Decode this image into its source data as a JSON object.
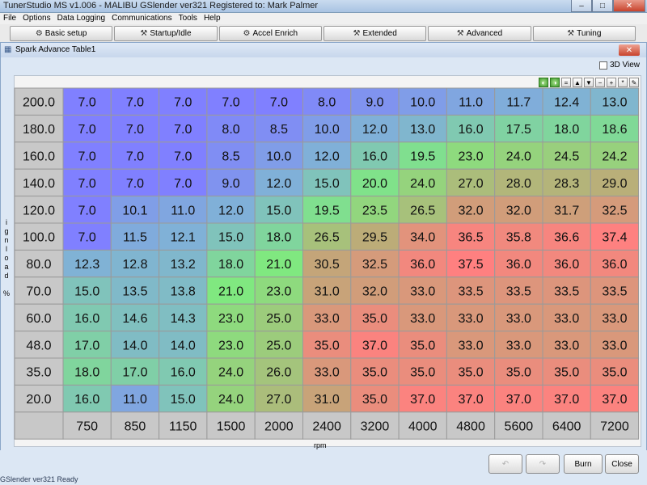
{
  "app": {
    "title": "TunerStudio MS v1.006 - MALIBU GSlender ver321 Registered to: Mark Palmer"
  },
  "window_controls": {
    "minimize": "–",
    "maximize": "□",
    "close": "✕"
  },
  "menu": [
    "File",
    "Options",
    "Data Logging",
    "Communications",
    "Tools",
    "Help"
  ],
  "toolbar": [
    {
      "label": "Basic setup",
      "icon": "engine-icon",
      "glyph": "⚙"
    },
    {
      "label": "Startup/Idle",
      "icon": "wrench-icon",
      "glyph": "⚒"
    },
    {
      "label": "Accel Enrich",
      "icon": "engine-icon",
      "glyph": "⚙"
    },
    {
      "label": "Extended",
      "icon": "hammer-icon",
      "glyph": "⚒"
    },
    {
      "label": "Advanced",
      "icon": "wrench-icon",
      "glyph": "⚒"
    },
    {
      "label": "Tuning",
      "icon": "tools-icon",
      "glyph": "⚒"
    }
  ],
  "dialog": {
    "title": "Spark Advance Table1",
    "close": "✕",
    "view3d_label": "3D View",
    "mini_toolbar": [
      "◐",
      "◑",
      "=",
      "▲",
      "▼",
      "−",
      "+",
      "*",
      "✎"
    ]
  },
  "table": {
    "y_axis_label": "ignload %",
    "x_axis_label": "rpm",
    "rows": [
      "200.0",
      "180.0",
      "160.0",
      "140.0",
      "120.0",
      "100.0",
      "80.0",
      "70.0",
      "60.0",
      "48.0",
      "35.0",
      "20.0"
    ],
    "cols": [
      "750",
      "850",
      "1150",
      "1500",
      "2000",
      "2400",
      "3200",
      "4000",
      "4800",
      "5600",
      "6400",
      "7200"
    ],
    "values": [
      [
        "7.0",
        "7.0",
        "7.0",
        "7.0",
        "7.0",
        "8.0",
        "9.0",
        "10.0",
        "11.0",
        "11.7",
        "12.4",
        "13.0"
      ],
      [
        "7.0",
        "7.0",
        "7.0",
        "8.0",
        "8.5",
        "10.0",
        "12.0",
        "13.0",
        "16.0",
        "17.5",
        "18.0",
        "18.6"
      ],
      [
        "7.0",
        "7.0",
        "7.0",
        "8.5",
        "10.0",
        "12.0",
        "16.0",
        "19.5",
        "23.0",
        "24.0",
        "24.5",
        "24.2"
      ],
      [
        "7.0",
        "7.0",
        "7.0",
        "9.0",
        "12.0",
        "15.0",
        "20.0",
        "24.0",
        "27.0",
        "28.0",
        "28.3",
        "29.0"
      ],
      [
        "7.0",
        "10.1",
        "11.0",
        "12.0",
        "15.0",
        "19.5",
        "23.5",
        "26.5",
        "32.0",
        "32.0",
        "31.7",
        "32.5"
      ],
      [
        "7.0",
        "11.5",
        "12.1",
        "15.0",
        "18.0",
        "26.5",
        "29.5",
        "34.0",
        "36.5",
        "35.8",
        "36.6",
        "37.4"
      ],
      [
        "12.3",
        "12.8",
        "13.2",
        "18.0",
        "21.0",
        "30.5",
        "32.5",
        "36.0",
        "37.5",
        "36.0",
        "36.0",
        "36.0"
      ],
      [
        "15.0",
        "13.5",
        "13.8",
        "21.0",
        "23.0",
        "31.0",
        "32.0",
        "33.0",
        "33.5",
        "33.5",
        "33.5",
        "33.5"
      ],
      [
        "16.0",
        "14.6",
        "14.3",
        "23.0",
        "25.0",
        "33.0",
        "35.0",
        "33.0",
        "33.0",
        "33.0",
        "33.0",
        "33.0"
      ],
      [
        "17.0",
        "14.0",
        "14.0",
        "23.0",
        "25.0",
        "35.0",
        "37.0",
        "35.0",
        "33.0",
        "33.0",
        "33.0",
        "33.0"
      ],
      [
        "18.0",
        "17.0",
        "16.0",
        "24.0",
        "26.0",
        "33.0",
        "35.0",
        "35.0",
        "35.0",
        "35.0",
        "35.0",
        "35.0"
      ],
      [
        "16.0",
        "11.0",
        "15.0",
        "24.0",
        "27.0",
        "31.0",
        "35.0",
        "37.0",
        "37.0",
        "37.0",
        "37.0",
        "37.0"
      ]
    ],
    "colors": {
      "low": "#8080ff",
      "mid_low": "#80b0d8",
      "mid": "#80e880",
      "mid_high": "#c0a878",
      "high": "#ff8080",
      "axis_cell": "#c8c8c8"
    }
  },
  "buttons": {
    "undo": "↶",
    "redo": "↷",
    "burn": "Burn",
    "close": "Close"
  },
  "status": "GSlender ver321 Ready"
}
